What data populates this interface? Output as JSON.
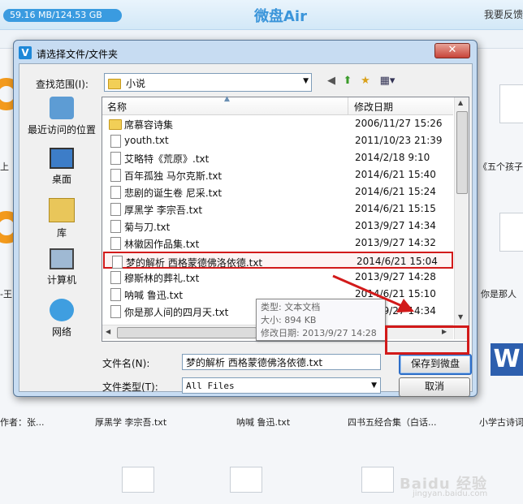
{
  "app": {
    "storage": "59.16 MB/124.53 GB",
    "title": "微盘Air",
    "feedback": "我要反馈",
    "bg_files": {
      "f1": "《五个孩子",
      "f2": "你是那人",
      "f3": "作者：张...",
      "f4": "厚黑学 李宗吾.txt",
      "f5": "呐喊 鲁迅.txt",
      "f6": "四书五经合集（白话...",
      "f7": "小学古诗词",
      "f8": "上",
      "f9": "-王"
    }
  },
  "dialog": {
    "title": "请选择文件/文件夹",
    "close": "✕",
    "look_in_label": "查找范围(I):",
    "look_in_value": "小说",
    "places": [
      "最近访问的位置",
      "桌面",
      "库",
      "计算机",
      "网络"
    ],
    "columns": {
      "name": "名称",
      "date": "修改日期"
    },
    "files": [
      {
        "name": "席慕容诗集",
        "date": "2006/11/27 15:26",
        "folder": true
      },
      {
        "name": "youth.txt",
        "date": "2011/10/23 21:39"
      },
      {
        "name": "艾略特《荒原》.txt",
        "date": "2014/2/18 9:10"
      },
      {
        "name": "百年孤独 马尔克斯.txt",
        "date": "2014/6/21 15:40"
      },
      {
        "name": "悲剧的诞生卷 尼采.txt",
        "date": "2014/6/21 15:24"
      },
      {
        "name": "厚黑学 李宗吾.txt",
        "date": "2014/6/21 15:15"
      },
      {
        "name": "菊与刀.txt",
        "date": "2013/9/27 14:34"
      },
      {
        "name": "林徽因作品集.txt",
        "date": "2013/9/27 14:32"
      },
      {
        "name": "梦的解析 西格蒙德佛洛依德.txt",
        "date": "2014/6/21 15:04",
        "selected": true
      },
      {
        "name": "穆斯林的葬礼.txt",
        "date": "2013/9/27 14:28"
      },
      {
        "name": "呐喊 鲁迅.txt",
        "date": "2014/6/21 15:10"
      },
      {
        "name": "你是那人间的四月天.txt",
        "date": "2013/9/27 14:34"
      }
    ],
    "tooltip": {
      "type": "类型: 文本文档",
      "size": "大小: 894 KB",
      "modified": "修改日期: 2013/9/27 14:28"
    },
    "filename_label": "文件名(N):",
    "filename_value": "梦的解析 西格蒙德佛洛依德.txt",
    "filetype_label": "文件类型(T):",
    "filetype_value": "All Files",
    "save_button": "保存到微盘",
    "cancel_button": "取消"
  },
  "watermark": {
    "brand": "Baidu 经验",
    "url": "jingyan.baidu.com"
  }
}
